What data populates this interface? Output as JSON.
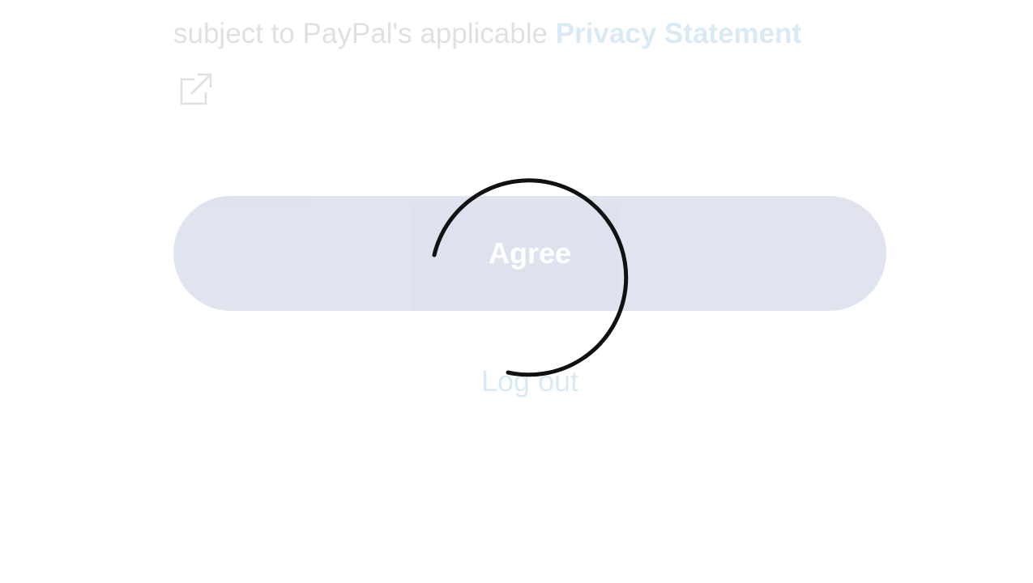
{
  "consent": {
    "text_prefix": "subject to PayPal's applicable ",
    "privacy_link_label": "Privacy Statement",
    "external_icon": "external-link-icon"
  },
  "actions": {
    "agree_label": "Agree",
    "logout_label": "Log out"
  },
  "loading": {
    "icon": "loading-spinner-icon"
  },
  "colors": {
    "brand_blue": "#0070ba",
    "button_blue": "#1d3d8f",
    "spinner": "#111111",
    "text": "#2c2e2f",
    "background": "#ffffff"
  }
}
